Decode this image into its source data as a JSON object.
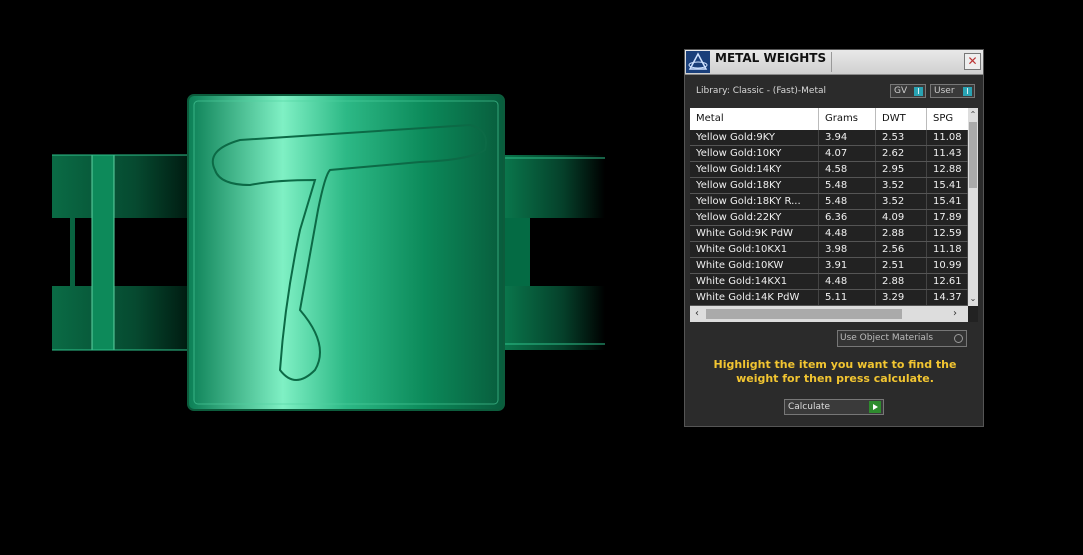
{
  "viewport": {
    "model_colors": {
      "base": "#0a6b45",
      "highlight": "#7ff0c4",
      "dark": "#00261a"
    }
  },
  "panel": {
    "title": "METAL WEIGHTS",
    "close_glyph": "✕",
    "library_label": "Library: Classic - (Fast)-Metal",
    "toggle_gv": "GV",
    "toggle_user": "User",
    "toggle_glyph": "I",
    "columns": [
      "Metal",
      "Grams",
      "DWT",
      "SPG"
    ],
    "rows": [
      [
        "Yellow Gold:9KY",
        "3.94",
        "2.53",
        "11.08"
      ],
      [
        "Yellow Gold:10KY",
        "4.07",
        "2.62",
        "11.43"
      ],
      [
        "Yellow Gold:14KY",
        "4.58",
        "2.95",
        "12.88"
      ],
      [
        "Yellow Gold:18KY",
        "5.48",
        "3.52",
        "15.41"
      ],
      [
        "Yellow Gold:18KY R...",
        "5.48",
        "3.52",
        "15.41"
      ],
      [
        "Yellow Gold:22KY",
        "6.36",
        "4.09",
        "17.89"
      ],
      [
        "White Gold:9K PdW",
        "4.48",
        "2.88",
        "12.59"
      ],
      [
        "White Gold:10KX1",
        "3.98",
        "2.56",
        "11.18"
      ],
      [
        "White Gold:10KW",
        "3.91",
        "2.51",
        "10.99"
      ],
      [
        "White Gold:14KX1",
        "4.48",
        "2.88",
        "12.61"
      ],
      [
        "White Gold:14K PdW",
        "5.11",
        "3.29",
        "14.37"
      ]
    ],
    "use_object_materials": "Use Object Materials",
    "instruction": "Highlight the item you want to find the weight for then press calculate.",
    "calculate_label": "Calculate",
    "accent": "#f2c531"
  }
}
